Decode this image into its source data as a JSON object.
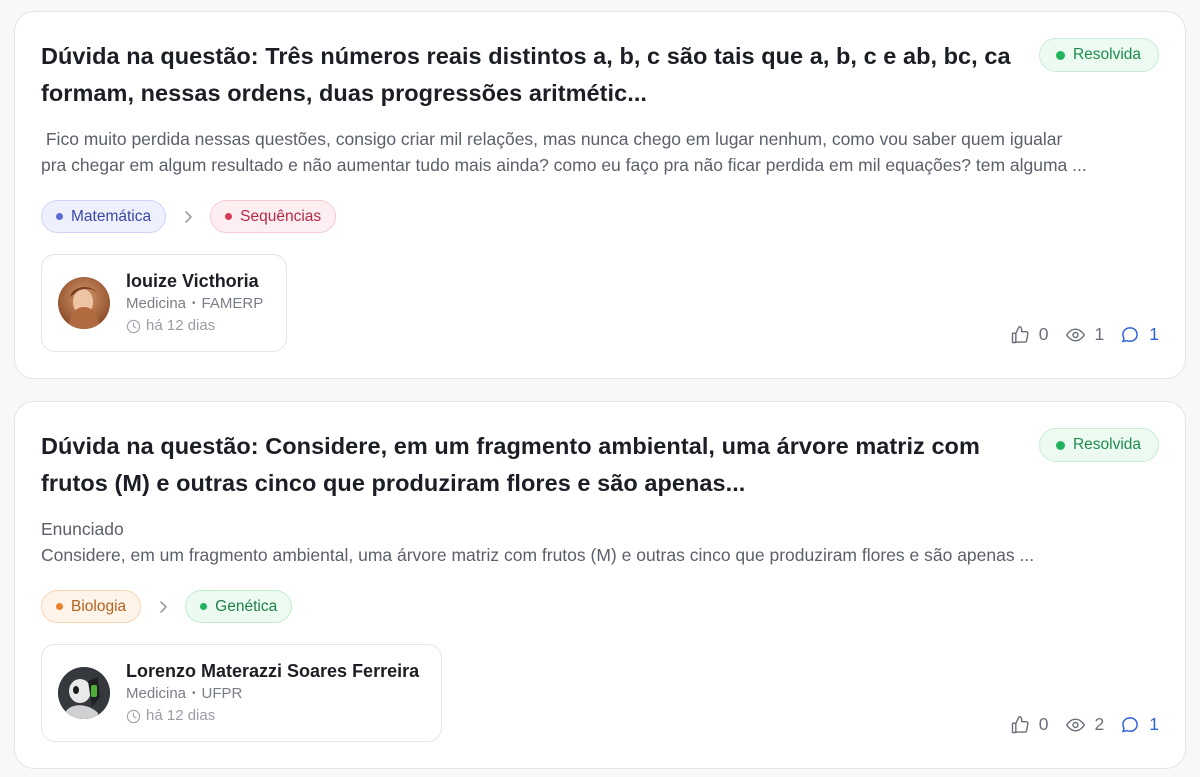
{
  "questions": [
    {
      "title_lines": [
        "Dúvida na questão: Três números reais distintos a, b, c são tais que a, b, c e ab, bc, ca",
        "formam, nessas ordens, duas progressões aritmétic..."
      ],
      "status": "Resolvida",
      "excerpt_lines": [
        " Fico muito perdida nessas questões, consigo criar mil relações, mas nunca chego em lugar nenhum, como vou saber quem igualar",
        "pra chegar em algum resultado e não aumentar tudo mais ainda? como eu faço pra não ficar perdida em mil equações? tem alguma ..."
      ],
      "tags": [
        {
          "label": "Matemática",
          "color": "#5b6ad0",
          "bg": "#eef0fd",
          "border": "#cdd3f5",
          "text": "#3a47a8"
        },
        {
          "label": "Sequências",
          "color": "#d83a55",
          "bg": "#fdeef1",
          "border": "#f5c9d2",
          "text": "#b42a45"
        }
      ],
      "author": {
        "name": "louize Victhoria",
        "course": "Medicina",
        "institution": "FAMERP",
        "time": "há 12 dias"
      },
      "stats": {
        "likes": "0",
        "views": "1",
        "comments": "1"
      }
    },
    {
      "title_lines": [
        "Dúvida na questão: Considere, em um fragmento ambiental, uma árvore matriz com",
        "frutos (M) e outras cinco que produziram flores e são apenas..."
      ],
      "status": "Resolvida",
      "excerpt_lines": [
        "Enunciado",
        "Considere, em um fragmento ambiental, uma árvore matriz com frutos (M) e outras cinco que produziram flores e são apenas ..."
      ],
      "tags": [
        {
          "label": "Biologia",
          "color": "#e8852b",
          "bg": "#fef4ea",
          "border": "#f7d5b3",
          "text": "#b4621c"
        },
        {
          "label": "Genética",
          "color": "#22b35e",
          "bg": "#ecfaf1",
          "border": "#c3ead1",
          "text": "#1f7f48"
        }
      ],
      "author": {
        "name": "Lorenzo Materazzi Soares Ferreira",
        "course": "Medicina",
        "institution": "UFPR",
        "time": "há 12 dias"
      },
      "stats": {
        "likes": "0",
        "views": "2",
        "comments": "1"
      }
    }
  ],
  "icons": {
    "status": "dot-icon",
    "separator": "chevron-right-icon",
    "time": "clock-icon",
    "likes": "thumbs-up-icon",
    "views": "eye-icon",
    "comments": "comment-icon"
  }
}
